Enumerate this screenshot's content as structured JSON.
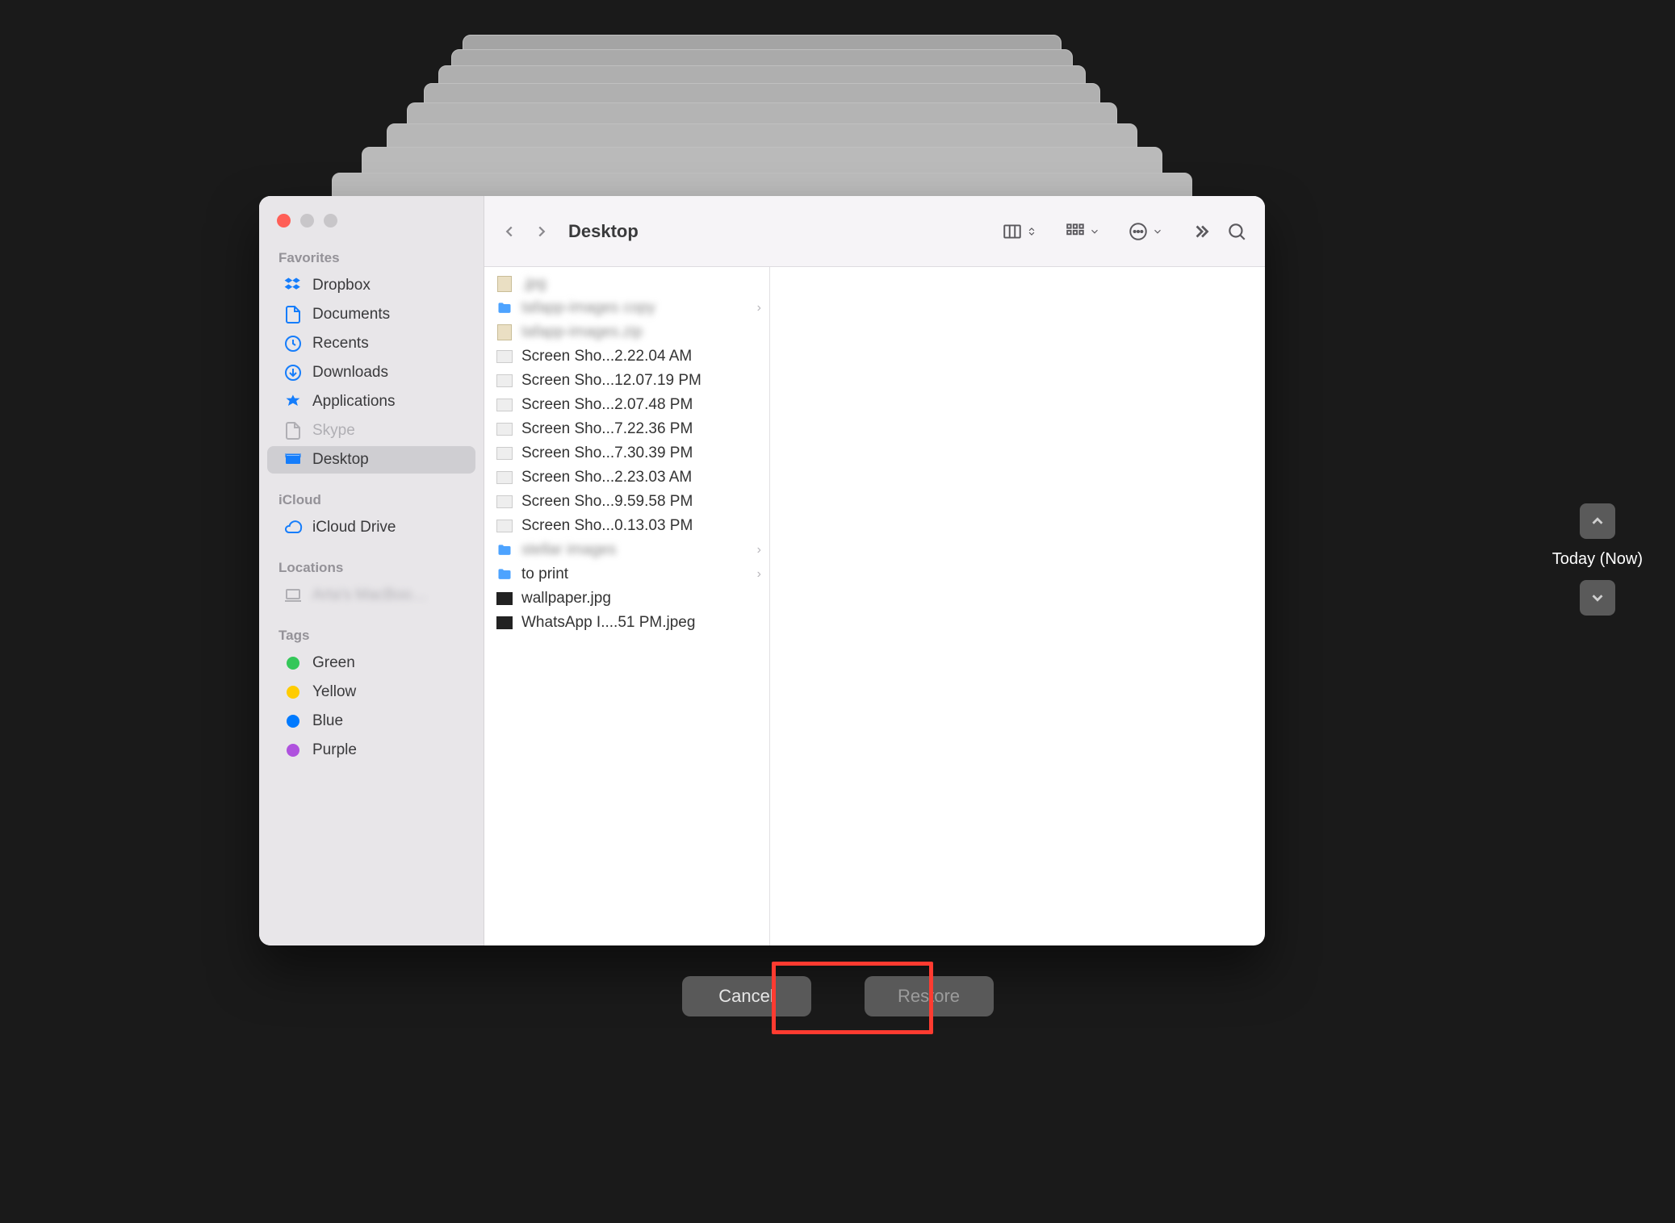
{
  "window": {
    "title": "Desktop"
  },
  "sidebar": {
    "sections": {
      "favorites_label": "Favorites",
      "icloud_label": "iCloud",
      "locations_label": "Locations",
      "tags_label": "Tags"
    },
    "favorites": [
      {
        "label": "Dropbox",
        "icon": "dropbox-icon"
      },
      {
        "label": "Documents",
        "icon": "document-icon"
      },
      {
        "label": "Recents",
        "icon": "clock-icon"
      },
      {
        "label": "Downloads",
        "icon": "download-icon"
      },
      {
        "label": "Applications",
        "icon": "applications-icon"
      },
      {
        "label": "Skype",
        "icon": "document-icon",
        "dim": true
      },
      {
        "label": "Desktop",
        "icon": "desktop-icon",
        "selected": true
      }
    ],
    "icloud": [
      {
        "label": "iCloud Drive",
        "icon": "cloud-icon"
      }
    ],
    "locations": [
      {
        "label": "Arta's MacBoo…",
        "icon": "laptop-icon",
        "dim": true,
        "blur": true
      }
    ],
    "tags": [
      {
        "label": "Green",
        "color": "green"
      },
      {
        "label": "Yellow",
        "color": "yellow"
      },
      {
        "label": "Blue",
        "color": "blue"
      },
      {
        "label": "Purple",
        "color": "purple"
      }
    ]
  },
  "files": [
    {
      "name": ".jpg",
      "icon": "zip",
      "blur": true
    },
    {
      "name": "tafapp-images copy",
      "icon": "folder",
      "blur": true,
      "chevron": true
    },
    {
      "name": "tafapp-images.zip",
      "icon": "zip",
      "blur": true
    },
    {
      "name": "Screen Sho...2.22.04 AM",
      "icon": "img"
    },
    {
      "name": "Screen Sho...12.07.19 PM",
      "icon": "img"
    },
    {
      "name": "Screen Sho...2.07.48 PM",
      "icon": "img"
    },
    {
      "name": "Screen Sho...7.22.36 PM",
      "icon": "img"
    },
    {
      "name": "Screen Sho...7.30.39 PM",
      "icon": "img"
    },
    {
      "name": "Screen Sho...2.23.03 AM",
      "icon": "img"
    },
    {
      "name": "Screen Sho...9.59.58 PM",
      "icon": "img"
    },
    {
      "name": "Screen Sho...0.13.03 PM",
      "icon": "img"
    },
    {
      "name": "stellar images",
      "icon": "folder",
      "blur": true,
      "chevron": true
    },
    {
      "name": "to print",
      "icon": "folder",
      "chevron": true
    },
    {
      "name": "wallpaper.jpg",
      "icon": "dark"
    },
    {
      "name": "WhatsApp I....51 PM.jpeg",
      "icon": "dark"
    }
  ],
  "timeline": {
    "label": "Today (Now)"
  },
  "buttons": {
    "cancel": "Cancel",
    "restore": "Restore"
  }
}
